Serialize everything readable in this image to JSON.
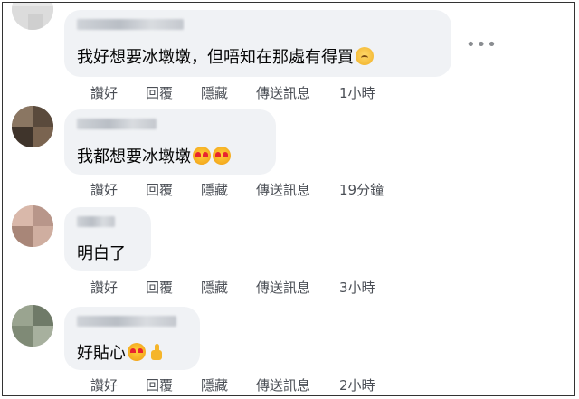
{
  "comments": [
    {
      "text": "我好想要冰墩墩，但唔知在那處有得買",
      "emoji": "sad-face-emoji",
      "actions": {
        "like": "讚好",
        "reply": "回覆",
        "hide": "隱藏",
        "message": "傳送訊息",
        "time": "1小時"
      }
    },
    {
      "text": "我都想要冰墩墩",
      "emoji": "heart-eyes-emoji-x2",
      "actions": {
        "like": "讚好",
        "reply": "回覆",
        "hide": "隱藏",
        "message": "傳送訊息",
        "time": "19分鐘"
      }
    },
    {
      "text": "明白了",
      "actions": {
        "like": "讚好",
        "reply": "回覆",
        "hide": "隱藏",
        "message": "傳送訊息",
        "time": "3小時"
      }
    },
    {
      "text": "好貼心",
      "emoji": "heart-eyes-and-thumbs-up-emoji",
      "actions": {
        "like": "讚好",
        "reply": "回覆",
        "hide": "隱藏",
        "message": "傳送訊息",
        "time": "2小時"
      }
    }
  ],
  "more_icon": "•••"
}
